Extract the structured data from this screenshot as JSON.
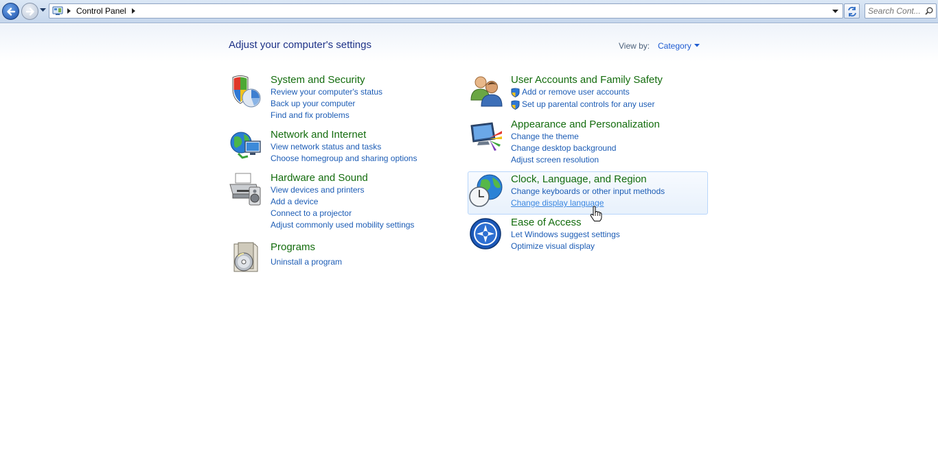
{
  "address_bar": {
    "breadcrumb": "Control Panel"
  },
  "search": {
    "placeholder": "Search Cont..."
  },
  "header": {
    "title": "Adjust your computer's settings",
    "view_by_label": "View by:",
    "view_by_value": "Category"
  },
  "categories": {
    "system_security": {
      "title": "System and Security",
      "links": [
        "Review your computer's status",
        "Back up your computer",
        "Find and fix problems"
      ]
    },
    "network_internet": {
      "title": "Network and Internet",
      "links": [
        "View network status and tasks",
        "Choose homegroup and sharing options"
      ]
    },
    "hardware_sound": {
      "title": "Hardware and Sound",
      "links": [
        "View devices and printers",
        "Add a device",
        "Connect to a projector",
        "Adjust commonly used mobility settings"
      ]
    },
    "programs": {
      "title": "Programs",
      "links": [
        "Uninstall a program"
      ]
    },
    "user_accounts": {
      "title": "User Accounts and Family Safety",
      "links": [
        "Add or remove user accounts",
        "Set up parental controls for any user"
      ]
    },
    "appearance": {
      "title": "Appearance and Personalization",
      "links": [
        "Change the theme",
        "Change desktop background",
        "Adjust screen resolution"
      ]
    },
    "clock_region": {
      "title": "Clock, Language, and Region",
      "links": [
        "Change keyboards or other input methods",
        "Change display language"
      ]
    },
    "ease_access": {
      "title": "Ease of Access",
      "links": [
        "Let Windows suggest settings",
        "Optimize visual display"
      ]
    }
  },
  "colors": {
    "category_title": "#136c0d",
    "link": "#1c5cb5",
    "page_title": "#1e3287",
    "hover_highlight": "#e8f1fc"
  }
}
